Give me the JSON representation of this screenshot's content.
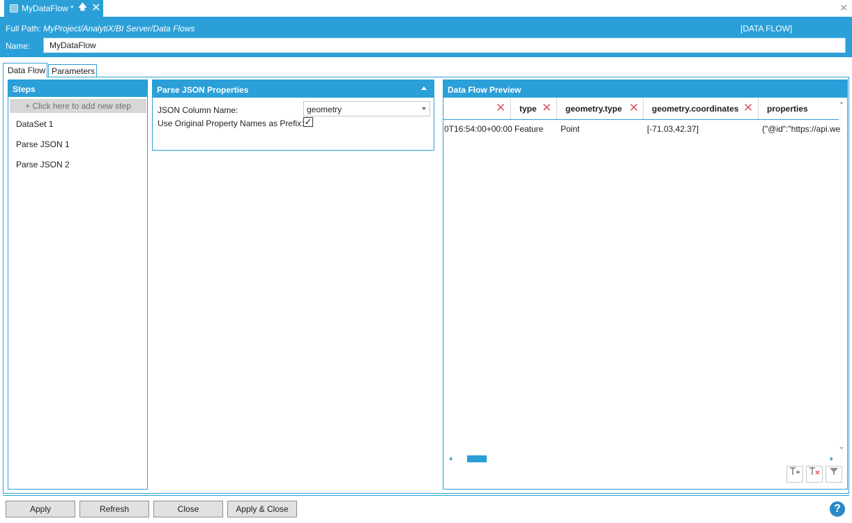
{
  "window": {
    "tab_title": "MyDataFlow *",
    "pin_glyph": "🡅",
    "tab_close_glyph": "✕",
    "window_close_glyph": "✕"
  },
  "header": {
    "fullpath_label": "Full Path:",
    "fullpath_value": "MyProject/AnalytiX/BI Server/Data Flows",
    "type_tag": "[DATA FLOW]",
    "name_label": "Name:",
    "name_value": "MyDataFlow"
  },
  "tabs": [
    {
      "label": "Data Flow",
      "active": true
    },
    {
      "label": "Parameters",
      "active": false
    }
  ],
  "steps": {
    "title": "Steps",
    "add_label": "+  Click here to add new step",
    "items": [
      "DataSet  1",
      "Parse JSON  1",
      "Parse JSON  2"
    ]
  },
  "parse_json": {
    "title": "Parse JSON Properties",
    "column_label": "JSON Column Name:",
    "column_value": "geometry",
    "prefix_label": "Use Original Property Names as Prefix:",
    "prefix_checked": "✓"
  },
  "preview": {
    "title": "Data Flow Preview",
    "columns": [
      "",
      "type",
      "geometry.type",
      "geometry.coordinates",
      "properties"
    ],
    "row": [
      "0T16:54:00+00:00",
      "Feature",
      "Point",
      "[-71.03,42.37]",
      "{\"@id\":\"https://api.we"
    ],
    "remove_glyph": "✕",
    "tools": [
      "add-column-icon",
      "remove-column-icon",
      "filter-icon"
    ]
  },
  "colors": {
    "accent": "#2a9fd8",
    "remove": "#e05757"
  },
  "footer": {
    "apply": "Apply",
    "refresh": "Refresh",
    "close": "Close",
    "apply_close": "Apply & Close",
    "help": "?"
  }
}
